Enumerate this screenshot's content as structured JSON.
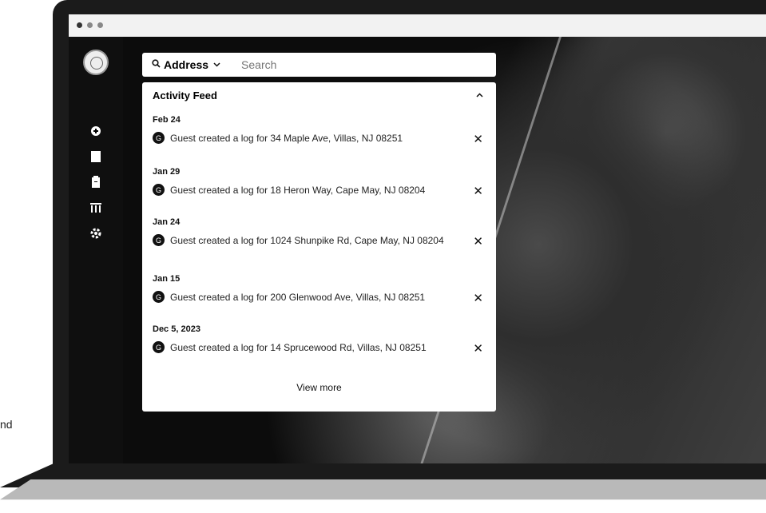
{
  "side_text": "nd",
  "search": {
    "mode_label": "Address",
    "placeholder": "Search"
  },
  "feed": {
    "title": "Activity Feed",
    "view_more": "View more",
    "entries": [
      {
        "date": "Feb 24",
        "message": "Guest created a log for 34 Maple Ave, Villas, NJ 08251"
      },
      {
        "date": "Jan 29",
        "message": "Guest created a log for 18 Heron Way, Cape May, NJ 08204"
      },
      {
        "date": "Jan 24",
        "message": "Guest created a log for 1024 Shunpike Rd, Cape May, NJ 08204"
      },
      {
        "date": "Jan 15",
        "message": "Guest created a log for 200 Glenwood Ave, Villas, NJ 08251"
      },
      {
        "date": "Dec 5, 2023",
        "message": "Guest created a log for 14 Sprucewood Rd, Villas, NJ 08251"
      }
    ]
  },
  "icons": {
    "search": "search-icon",
    "chevron": "chevron-down-icon",
    "collapse": "chevron-up-icon",
    "close": "close-icon",
    "settings": "gear-icon"
  }
}
